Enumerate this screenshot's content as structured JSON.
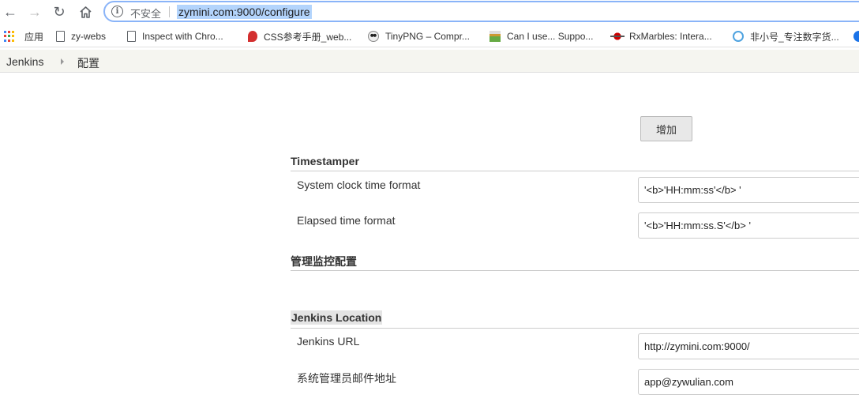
{
  "browser": {
    "security_label": "不安全",
    "url": "zymini.com:9000/configure"
  },
  "bookmarks": [
    {
      "label": "应用",
      "icon": "apps-icon"
    },
    {
      "label": "zy-webs",
      "icon": "page-icon"
    },
    {
      "label": "Inspect with Chro...",
      "icon": "page-icon"
    },
    {
      "label": "CSS参考手册_web...",
      "icon": "css-icon"
    },
    {
      "label": "TinyPNG – Compr...",
      "icon": "panda-icon"
    },
    {
      "label": "Can I use... Suppo...",
      "icon": "caniuse-icon"
    },
    {
      "label": "RxMarbles: Intera...",
      "icon": "rxmarbles-icon"
    },
    {
      "label": "非小号_专注数字货...",
      "icon": "feixiaohao-icon"
    }
  ],
  "breadcrumb": {
    "root": "Jenkins",
    "current": "配置"
  },
  "form": {
    "add_button": "增加",
    "timestamper": {
      "title": "Timestamper",
      "system_clock_label": "System clock time format",
      "system_clock_value": "'<b>'HH:mm:ss'</b> '",
      "elapsed_label": "Elapsed time format",
      "elapsed_value": "'<b>'HH:mm:ss.S'</b> '"
    },
    "monitoring": {
      "title": "管理监控配置"
    },
    "location": {
      "title": "Jenkins Location",
      "url_label": "Jenkins URL",
      "url_value": "http://zymini.com:9000/",
      "email_label": "系统管理员邮件地址",
      "email_value": "app@zywulian.com"
    }
  }
}
